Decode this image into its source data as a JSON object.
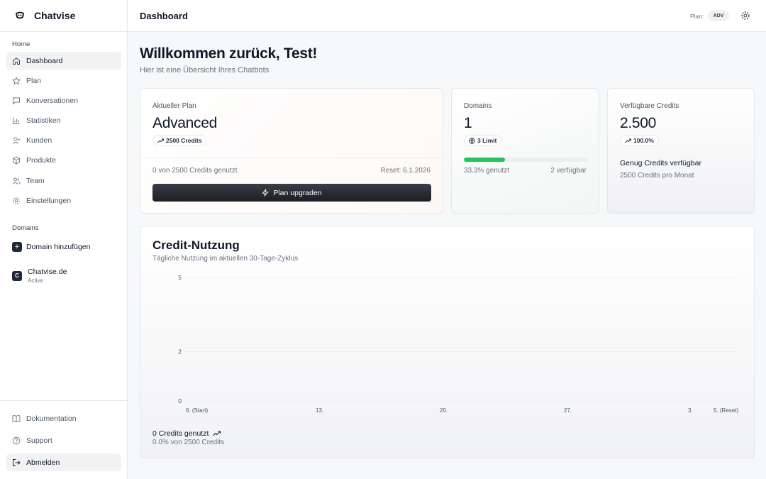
{
  "app": {
    "name": "Chatvise"
  },
  "sidebar": {
    "section_home": "Home",
    "items": [
      {
        "label": "Dashboard",
        "icon": "home-icon"
      },
      {
        "label": "Plan",
        "icon": "star-icon"
      },
      {
        "label": "Konversationen",
        "icon": "chat-icon"
      },
      {
        "label": "Statistiken",
        "icon": "bar-chart-icon"
      },
      {
        "label": "Kunden",
        "icon": "user-icon"
      },
      {
        "label": "Produkte",
        "icon": "box-icon"
      },
      {
        "label": "Team",
        "icon": "users-icon"
      },
      {
        "label": "Einstellungen",
        "icon": "gear-icon"
      }
    ],
    "section_domains": "Domains",
    "add_domain": "Domain hinzufügen",
    "domain": {
      "initial": "C",
      "name": "Chatvise.de",
      "status": "Active"
    },
    "bottom": [
      {
        "label": "Dokumentation",
        "icon": "book-icon"
      },
      {
        "label": "Support",
        "icon": "help-icon"
      },
      {
        "label": "Abmelden",
        "icon": "logout-icon"
      }
    ]
  },
  "header": {
    "title": "Dashboard",
    "plan_label": "Plan:",
    "plan_badge": "ADV"
  },
  "welcome": {
    "title": "Willkommen zurück, Test!",
    "subtitle": "Hier ist eine Übersicht Ihres Chatbots"
  },
  "plan_card": {
    "label": "Aktueller Plan",
    "plan": "Advanced",
    "badge": "2500 Credits",
    "usage": "0 von 2500 Credits genutzt",
    "reset": "Reset: 6.1.2026",
    "button": "Plan upgraden"
  },
  "domains_card": {
    "label": "Domains",
    "value": "1",
    "badge": "3 Limit",
    "progress": 0.333,
    "used": "33.3% genutzt",
    "available": "2 verfügbar",
    "accent": "#22c55e"
  },
  "credits_card": {
    "label": "Verfügbare Credits",
    "value": "2.500",
    "badge": "100.0%",
    "status": "Genug Credits verfügbar",
    "per_month": "2500 Credits pro Monat"
  },
  "usage_card": {
    "title": "Credit-Nutzung",
    "subtitle": "Tägliche Nutzung im aktuellen 30-Tage-Zyklus",
    "total": "0 Credits genutzt",
    "percent": "0.0% von 2500 Credits"
  },
  "chart_data": {
    "type": "line",
    "x_ticks": [
      "6. (Start)",
      "13.",
      "20.",
      "27.",
      "3.",
      "5. (Reset)"
    ],
    "y_ticks": [
      "5",
      "2",
      "0"
    ],
    "ylim": [
      0,
      5
    ],
    "series": [
      {
        "values": []
      }
    ],
    "grid": true
  }
}
